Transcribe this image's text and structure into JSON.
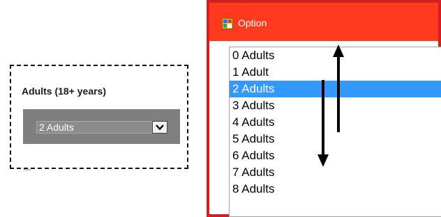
{
  "left_panel": {
    "label": "Adults (18+ years)",
    "selected_value": "2 Adults"
  },
  "dialog": {
    "title": "Option",
    "options": [
      "0 Adults",
      "1 Adult",
      "2 Adults",
      "3 Adults",
      "4 Adults",
      "5 Adults",
      "6 Adults",
      "7 Adults",
      "8 Adults"
    ],
    "selected_index": 2
  },
  "colors": {
    "titlebar": "#ff3a1f",
    "dialog_border": "#d31f1f",
    "selection": "#3399ff",
    "dropdown_bg": "#7f7f7f"
  },
  "icons": [
    "app-window-icon",
    "chevron-down-icon",
    "arrow-up-icon",
    "arrow-down-icon"
  ]
}
